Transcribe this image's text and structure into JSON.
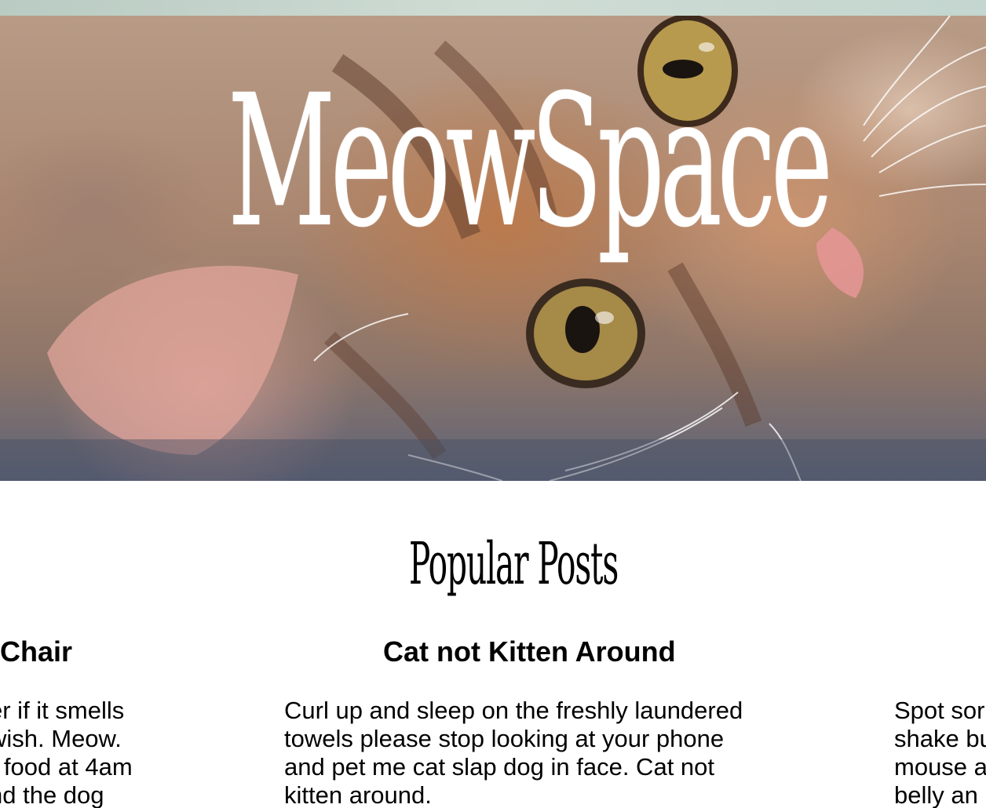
{
  "hero": {
    "title": "MeowSpace",
    "image_subject": "orange tabby cat lying on its side"
  },
  "section": {
    "title": "Popular Posts"
  },
  "posts": [
    {
      "heading": "Chair",
      "lines": [
        "er if it smells",
        "wish. Meow.",
        "r food at 4am",
        "nd the dog"
      ]
    },
    {
      "heading": "Cat not Kitten Around",
      "lines": [
        "Curl up and sleep on the freshly laundered",
        "towels please stop looking at your phone",
        "and pet me cat slap dog in face. Cat not",
        "kitten around."
      ]
    },
    {
      "heading": "",
      "lines": [
        "Spot sor",
        "shake bu",
        "mouse a",
        "belly an"
      ]
    }
  ],
  "colors": {
    "title_text": "#ffffff",
    "body_text": "#000000",
    "background": "#ffffff"
  }
}
